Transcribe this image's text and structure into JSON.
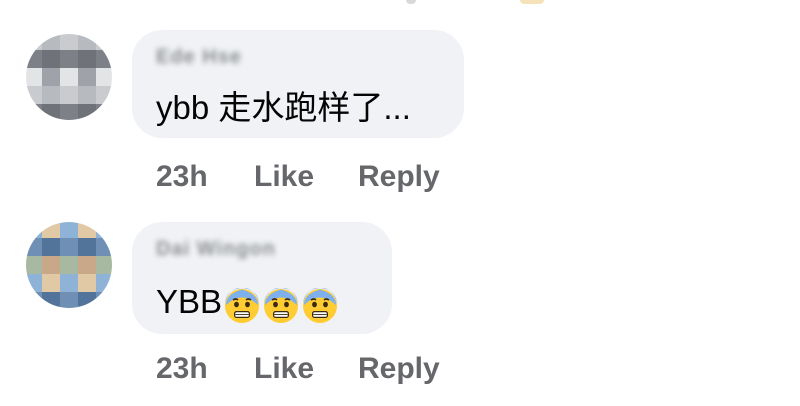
{
  "comments": [
    {
      "author": "Ede Hse",
      "text": "ybb 走水跑样了...",
      "time": "23h",
      "like_label": "Like",
      "reply_label": "Reply",
      "avatar_colors": [
        "#c9cbcf",
        "#9fa2a8",
        "#7d8087",
        "#b7babe",
        "#e3e4e6",
        "#6f7278"
      ]
    },
    {
      "author": "Dai Wingon",
      "text": "YBB",
      "emojis": [
        "anguished-face-icon",
        "anguished-face-icon",
        "anguished-face-icon"
      ],
      "time": "23h",
      "like_label": "Like",
      "reply_label": "Reply",
      "avatar_colors": [
        "#8fb3d6",
        "#c8a889",
        "#6f8fb4",
        "#e2c9a6",
        "#a7b9a0",
        "#52739a"
      ]
    }
  ]
}
